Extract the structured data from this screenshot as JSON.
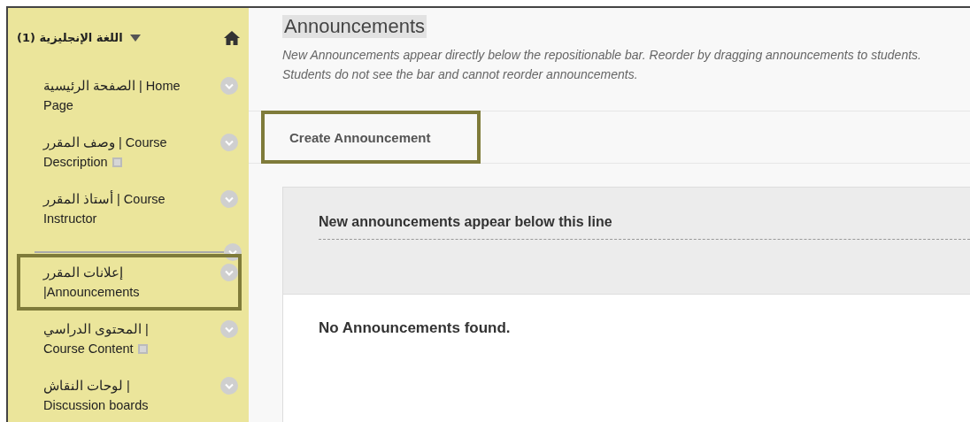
{
  "sidebar": {
    "course_title": "اللغة الإنجليزية (1)",
    "expanded": true,
    "items": [
      {
        "label": "الصفحة الرئيسية | Home Page",
        "selected": false,
        "has_page_icon": false
      },
      {
        "label": "وصف المقرر | Course Description",
        "selected": false,
        "has_page_icon": true
      },
      {
        "label": "أستاذ المقرر | Course Instructor",
        "selected": false,
        "has_page_icon": false
      },
      {
        "label": "إعلانات المقرر |Announcements",
        "selected": true,
        "has_page_icon": false,
        "divider_before": true
      },
      {
        "label": "المحتوى الدراسي | Course Content",
        "selected": false,
        "has_page_icon": true
      },
      {
        "label": "لوحات النقاش | Discussion boards",
        "selected": false,
        "has_page_icon": false
      }
    ]
  },
  "main": {
    "title": "Announcements",
    "description": "New Announcements appear directly below the repositionable bar. Reorder by dragging announcements to students. Students do not see the bar and cannot reorder announcements.",
    "create_button": "Create Announcement",
    "bar_label": "New announcements appear below this line",
    "empty_message": "No Announcements found."
  }
}
